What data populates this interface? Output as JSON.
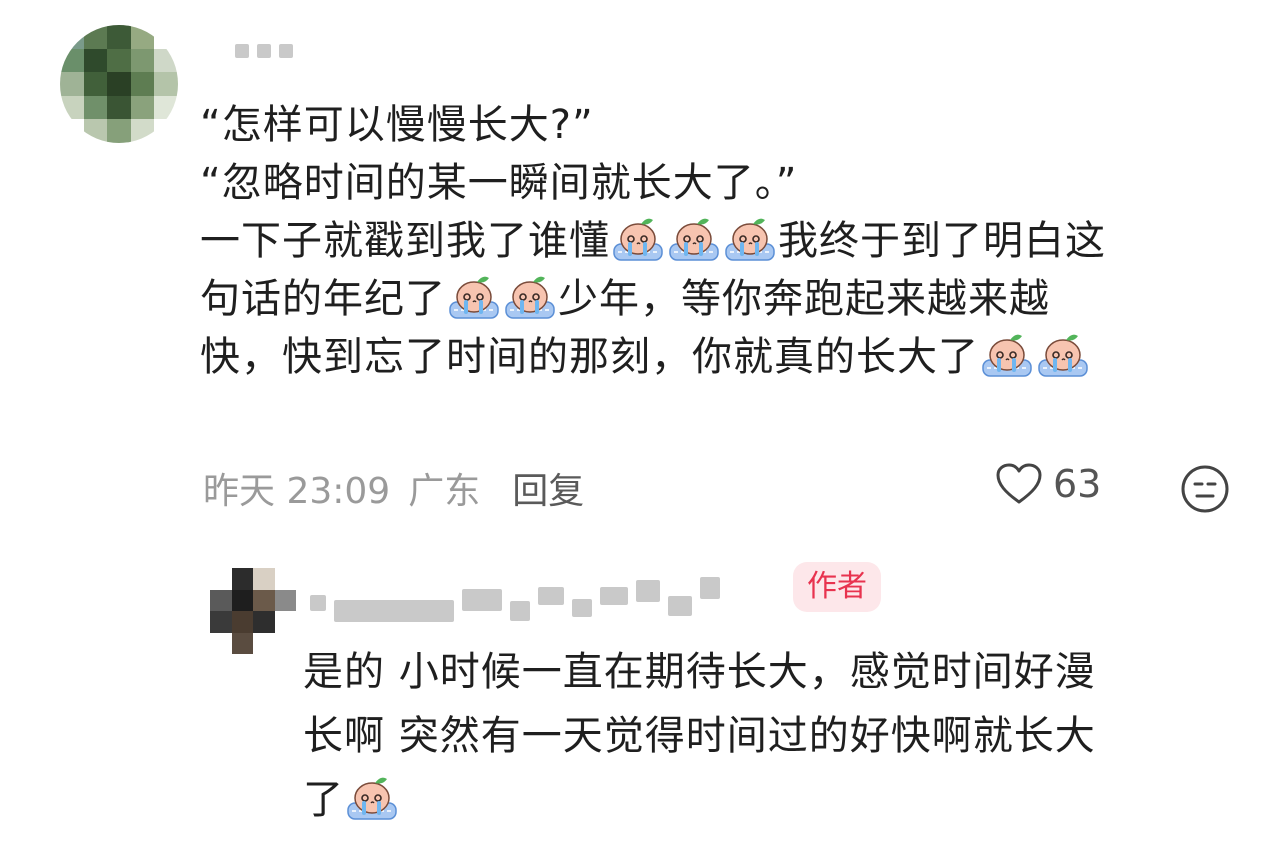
{
  "comment": {
    "lines": [
      "“怎样可以慢慢长大?”",
      "“忽略时间的某一瞬间就长大了。”"
    ],
    "body_parts": [
      "一下子就戳到我了谁懂",
      "我终于到了明白这",
      "句话的年纪了",
      "少年，等你奔跑起来越来越",
      "快，快到忘了时间的那刻，你就真的长大了"
    ],
    "time": "昨天 23:09",
    "location": "广东",
    "reply_label": "回复",
    "likes": "63"
  },
  "reply": {
    "author_badge": "作者",
    "line1": "是的 小时候一直在期待长大，感觉时间好漫",
    "line2": "长啊 突然有一天觉得时间过的好快啊就长大",
    "line3": "了"
  },
  "icons": {
    "emoji": "crying-peach-emoji",
    "like": "heart-icon",
    "face": "emoji-face-icon"
  },
  "colors": {
    "badge_bg": "#fde7ea",
    "badge_text": "#e8334f",
    "meta_text": "#9a9a9a"
  }
}
